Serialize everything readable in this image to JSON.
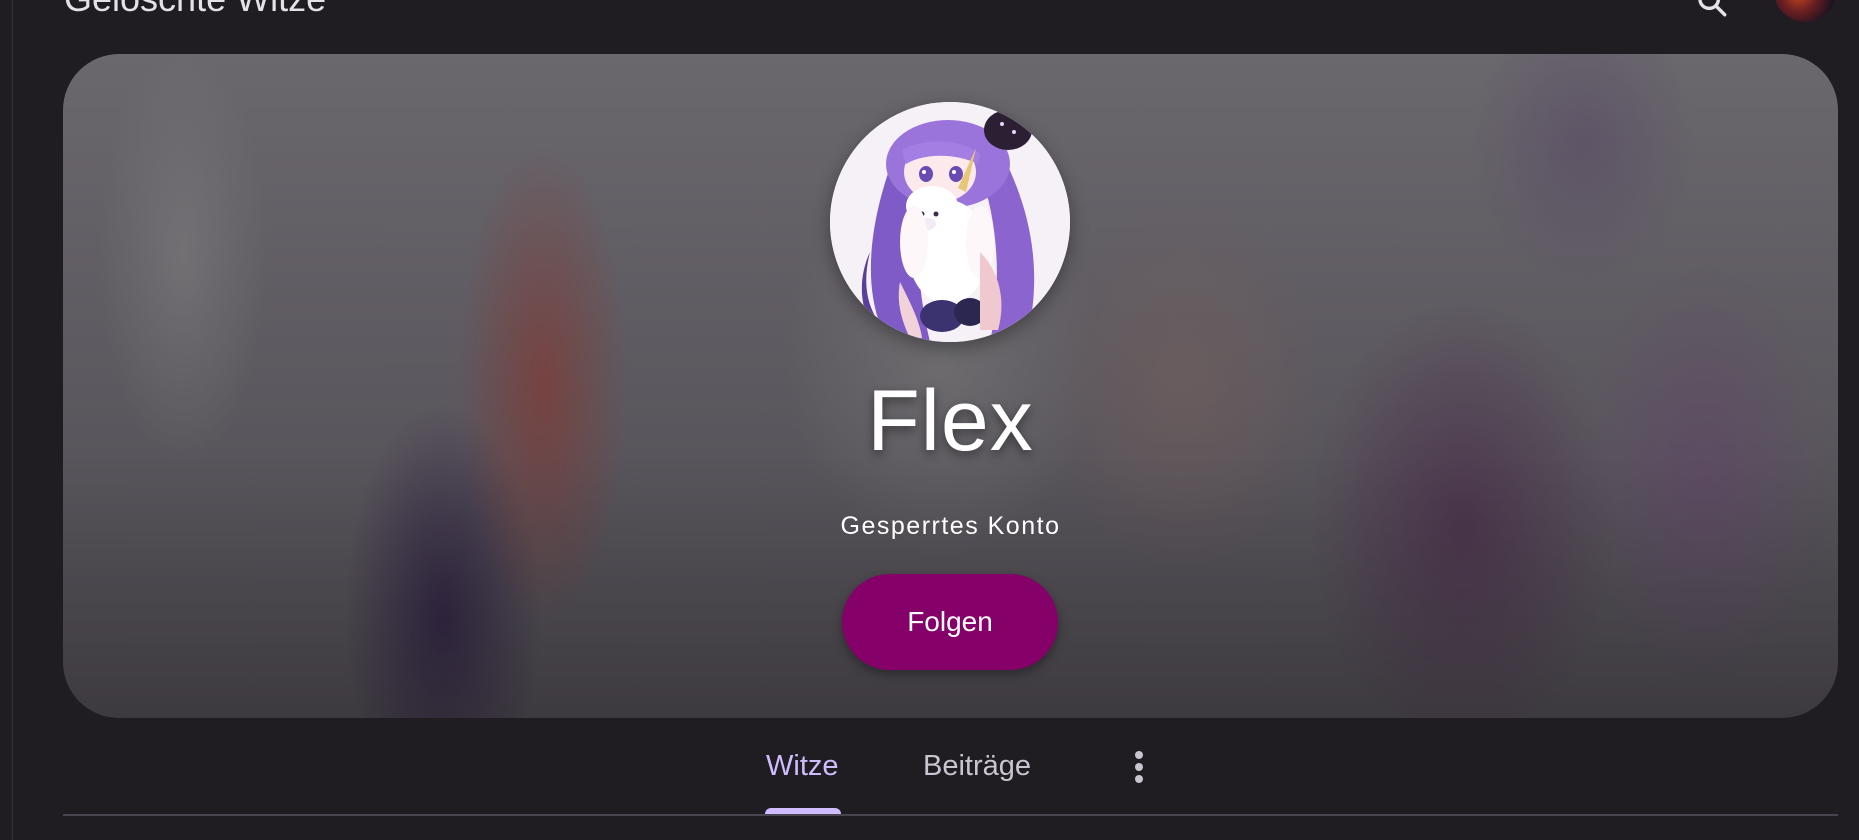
{
  "topbar": {
    "title": "Gelöschte Witze",
    "search_icon": "search-icon",
    "account_avatar": "user-avatar"
  },
  "profile": {
    "name": "Flex",
    "status": "Gesperrtes Konto",
    "follow_label": "Folgen",
    "avatar_icon": "anime-girl-with-unicorn-avatar"
  },
  "tabs": {
    "items": [
      {
        "label": "Witze",
        "selected": true
      },
      {
        "label": "Beiträge",
        "selected": false
      }
    ],
    "more_icon": "more-vert-icon"
  },
  "colors": {
    "background": "#1f1c22",
    "accent": "#cfbcff",
    "follow_button": "#860069",
    "tab_inactive": "#cac4d0"
  }
}
